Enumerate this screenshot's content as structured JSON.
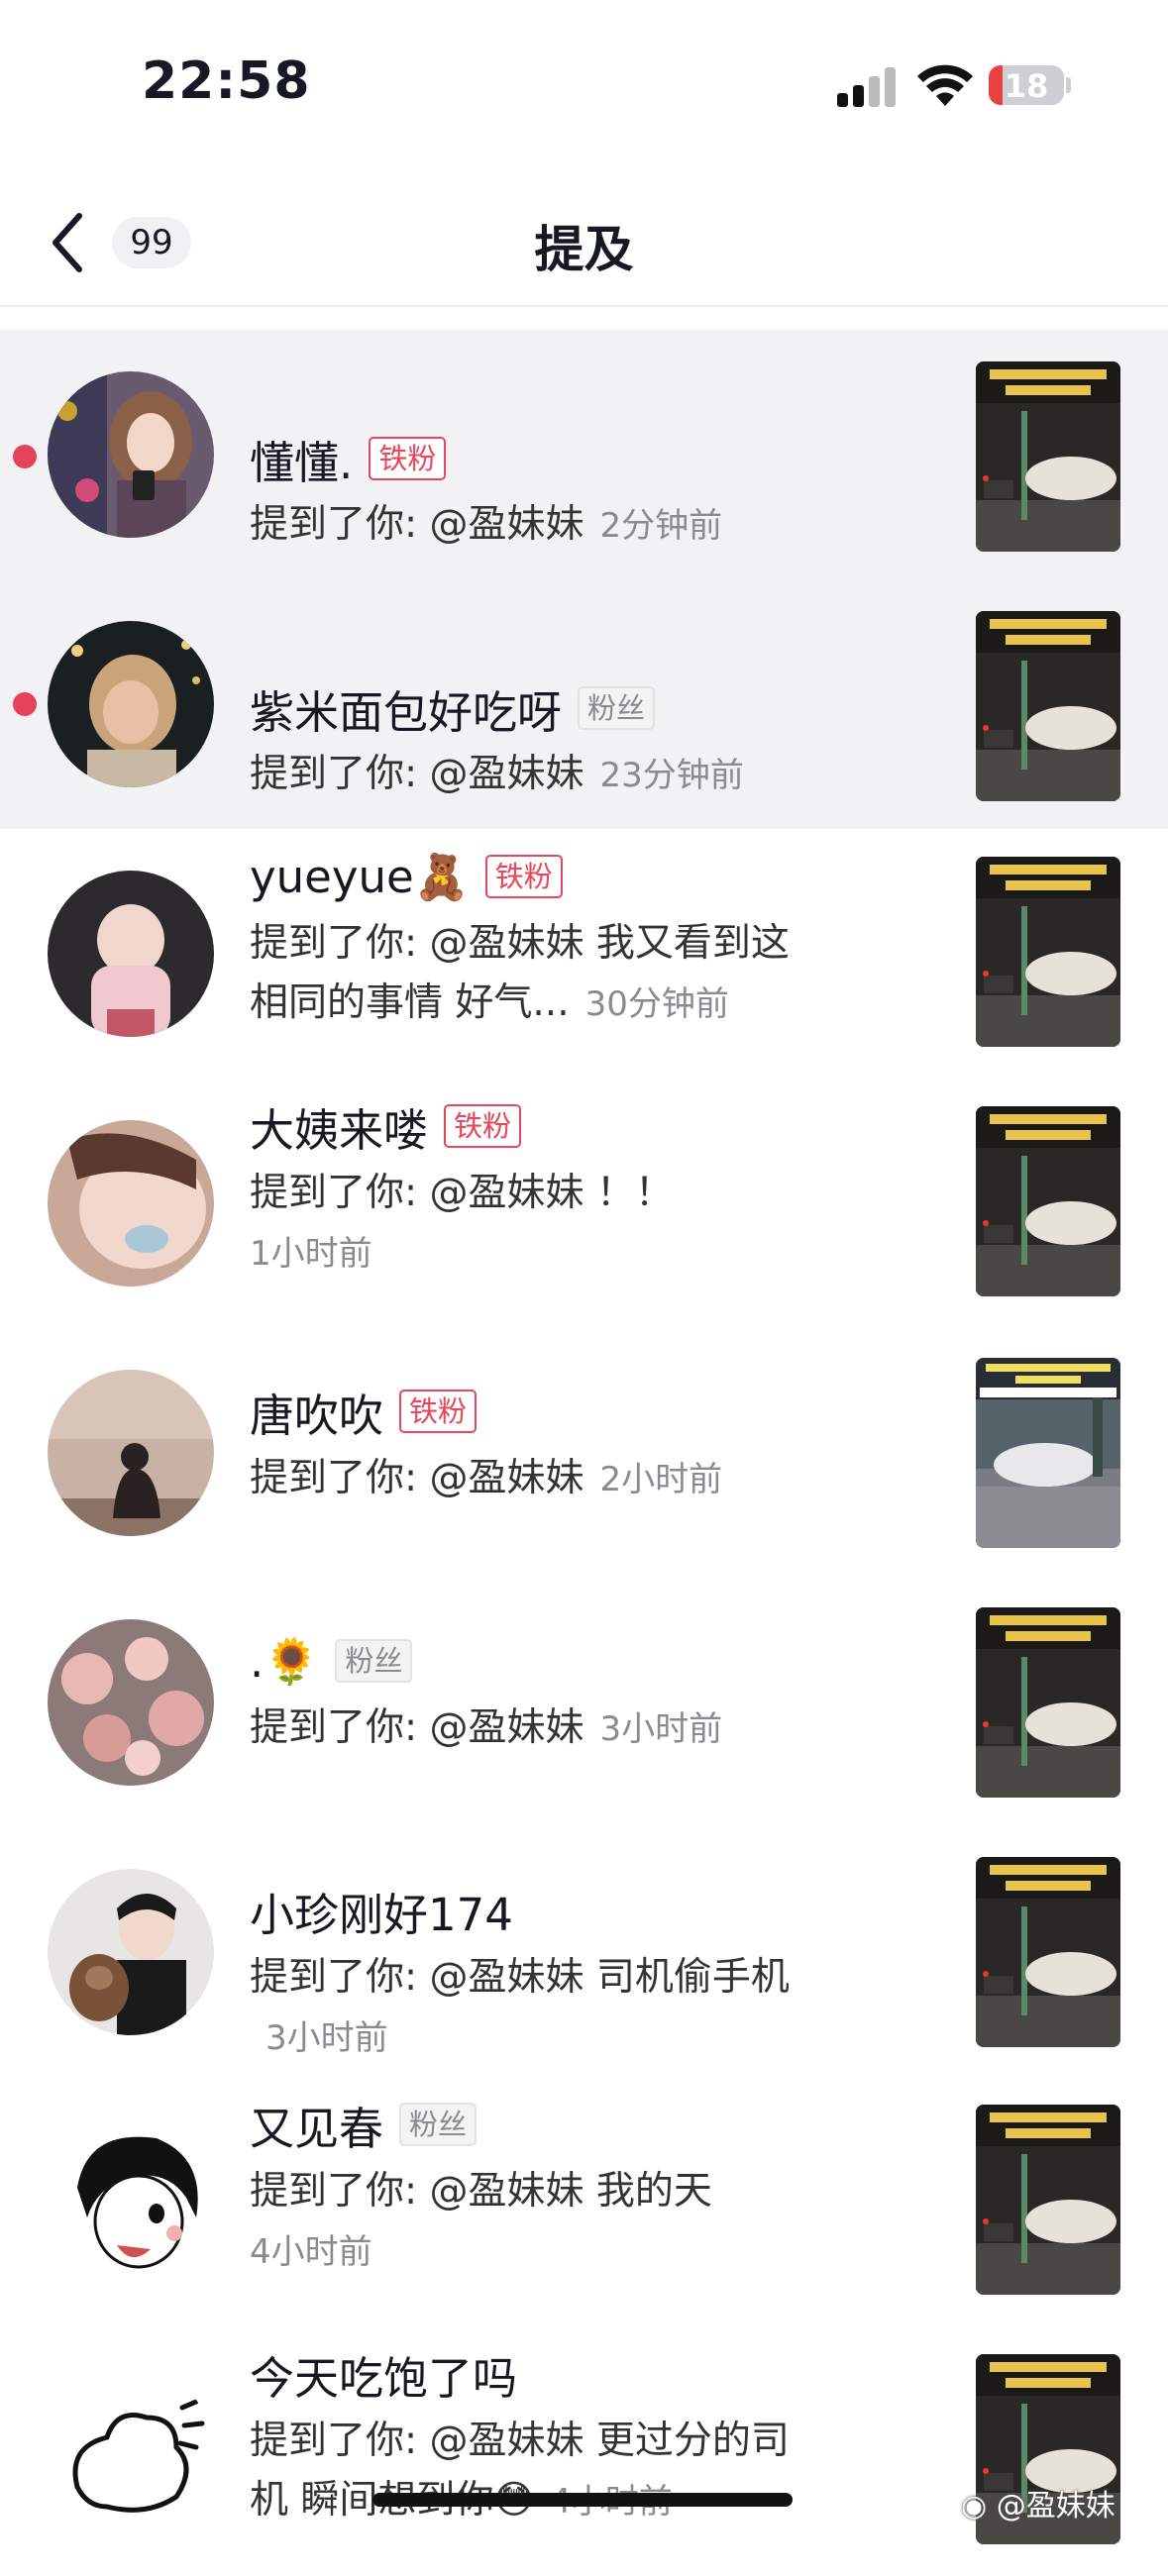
{
  "status_bar": {
    "time": "22:58",
    "battery": "18"
  },
  "nav": {
    "back_count": "99",
    "title": "提及"
  },
  "mentions": [
    {
      "name": "懂懂.",
      "badge": "铁粉",
      "badge_style": "red",
      "text": "提到了你: @盈妹妹",
      "time": "2分钟前",
      "unread": true
    },
    {
      "name": "紫米面包好吃呀",
      "badge": "粉丝",
      "badge_style": "gray",
      "text": "提到了你: @盈妹妹",
      "time": "23分钟前",
      "unread": true
    },
    {
      "name": "yueyue🧸",
      "badge": "铁粉",
      "badge_style": "red",
      "text": "提到了你: @盈妹妹 我又看到这相同的事情 好气...",
      "time": "30分钟前",
      "unread": false
    },
    {
      "name": "大姨来喽",
      "badge": "铁粉",
      "badge_style": "red",
      "text": "提到了你: @盈妹妹 ！！",
      "time": "1小时前",
      "unread": false
    },
    {
      "name": "唐吹吹",
      "badge": "铁粉",
      "badge_style": "red",
      "text": "提到了你: @盈妹妹",
      "time": "2小时前",
      "unread": false
    },
    {
      "name": ".🌻",
      "badge": "粉丝",
      "badge_style": "gray",
      "text": "提到了你: @盈妹妹",
      "time": "3小时前",
      "unread": false
    },
    {
      "name": "小珍刚好174",
      "badge": "",
      "badge_style": "none",
      "text": "提到了你: @盈妹妹 司机偷手机",
      "time": "3小时前",
      "unread": false
    },
    {
      "name": "又见春",
      "badge": "粉丝",
      "badge_style": "gray",
      "text": "提到了你: @盈妹妹 我的天",
      "time": "4小时前",
      "unread": false
    },
    {
      "name": "今天吃饱了吗",
      "badge": "",
      "badge_style": "none",
      "text": "提到了你: @盈妹妹 更过分的司机 瞬间想到你😳",
      "time": "4小时前",
      "unread": false
    }
  ],
  "watermark": "@盈妹妹",
  "colors": {
    "unread_bg": "#f2f2f4",
    "unread_dot": "#e4435a",
    "badge_red": "#e8465c"
  },
  "icons": [
    "back-chevron-icon",
    "cellular-signal-icon",
    "wifi-icon",
    "battery-icon",
    "weibo-logo-icon"
  ]
}
